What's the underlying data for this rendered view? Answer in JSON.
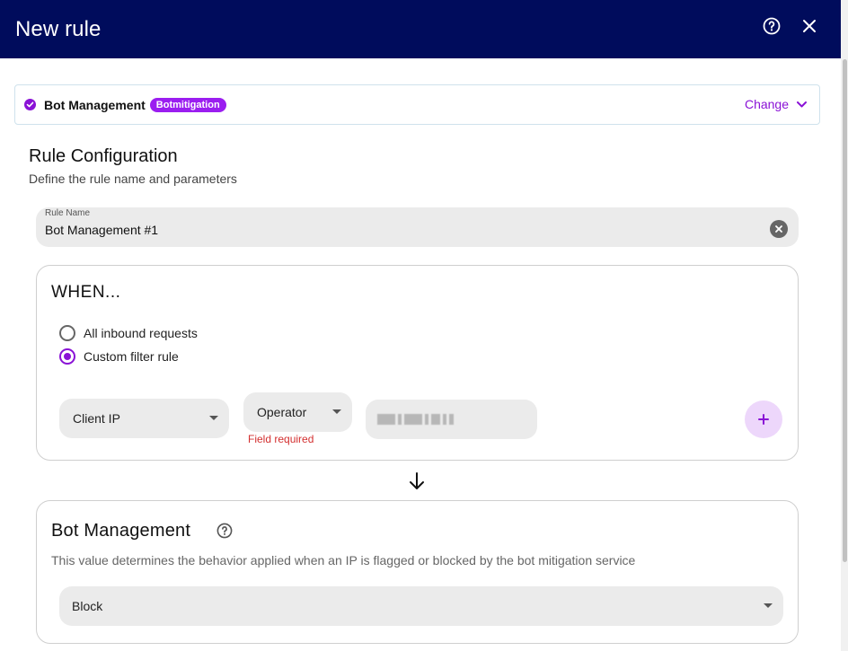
{
  "header": {
    "title": "New rule",
    "help_icon": "help-circle-icon",
    "close_icon": "close-icon"
  },
  "service": {
    "name": "Bot Management",
    "badge": "Botmitigation",
    "change_label": "Change"
  },
  "rule_config": {
    "title": "Rule Configuration",
    "subtitle": "Define the rule name and parameters",
    "name_label": "Rule Name",
    "name_value": "Bot Management #1"
  },
  "when": {
    "title": "WHEN...",
    "options": [
      {
        "label": "All inbound requests",
        "selected": false
      },
      {
        "label": "Custom filter rule",
        "selected": true
      }
    ],
    "field_select": "Client IP",
    "operator_select": "Operator",
    "operator_error": "Field required"
  },
  "bot_management": {
    "title": "Bot Management",
    "description": "This value determines the behavior applied when an IP is flagged or blocked by the bot mitigation service",
    "action_value": "Block"
  },
  "colors": {
    "header_bg": "#000c5c",
    "accent": "#8a12d6",
    "error": "#d32f2f"
  }
}
